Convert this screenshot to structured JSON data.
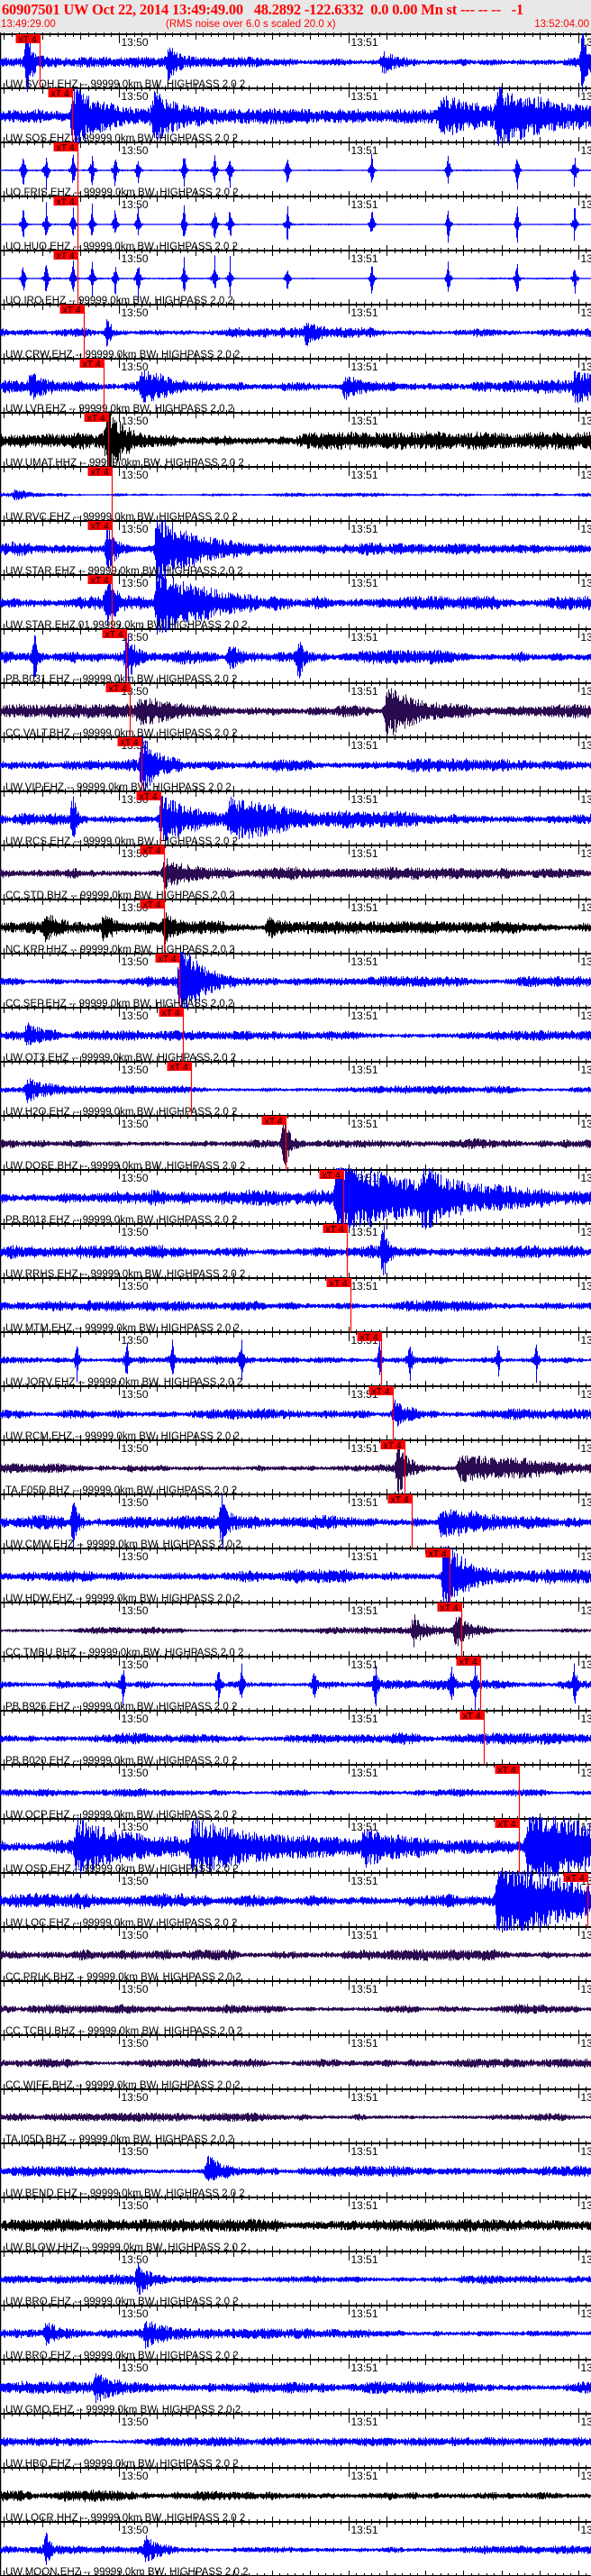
{
  "header": {
    "title": "60907501 UW Oct 22, 2014 13:49:49.00   48.2892 -122.6332  0.0 0.00 Mn st --- -- --   -1",
    "start_time": "13:49:29.00",
    "note": "(RMS noise over 6.0 s scaled 20.0 x)",
    "end_time": "13:52:04.00"
  },
  "chart_data": {
    "type": "line",
    "title": "60907501 UW Oct 22, 2014 13:49:49.00",
    "x_unit": "seconds after 13:49:29.00",
    "xlim": [
      0,
      154.4
    ],
    "tick_labels": [
      {
        "t": 31,
        "text": "13:50"
      },
      {
        "t": 91,
        "text": "13:51"
      },
      {
        "t": 151,
        "text": "13"
      }
    ],
    "pick_label": "xT 4",
    "colors": {
      "blue": "#0000ff",
      "black": "#000000",
      "purple": "#2a0a50",
      "pick": "#ff0000"
    },
    "traces": [
      {
        "label": "UW.SVOH.EHZ -- 99999.0km BW. HIGHPASS  2.0  2",
        "color": "blue",
        "noise": 0.15,
        "pick": 10.4,
        "events": [
          [
            7,
            1.1,
            1.5
          ],
          [
            44,
            0.6,
            2
          ],
          [
            100,
            0.4,
            3
          ],
          [
            152,
            1.1,
            1.5
          ]
        ]
      },
      {
        "label": "UW.SOS.EHZ -- 99999.0km BW. HIGHPASS  2.0  2",
        "color": "blue",
        "noise": 0.2,
        "pick": 18.8,
        "events": [
          [
            19,
            1.1,
            10
          ],
          [
            40,
            0.7,
            10
          ],
          [
            115,
            0.6,
            15
          ],
          [
            130,
            0.9,
            15
          ]
        ]
      },
      {
        "label": "UO.FRIS.EHZ -- 99999.0km BW. HIGHPASS  2.0  2",
        "color": "blue",
        "noise": 0.03,
        "pick": 20.2,
        "spikes": [
          6,
          12,
          19,
          24,
          30,
          36,
          48,
          56,
          60,
          75,
          97,
          117,
          135,
          150
        ]
      },
      {
        "label": "UO.HUO.EHZ -- 99999.0km BW. HIGHPASS  2.0  2",
        "color": "blue",
        "noise": 0.03,
        "pick": 20.2,
        "spikes": [
          6,
          12,
          19,
          24,
          30,
          36,
          48,
          56,
          60,
          75,
          97,
          117,
          135,
          150
        ]
      },
      {
        "label": "UO.IRO.EHZ -- 99999.0km BW. HIGHPASS  2.0  2",
        "color": "blue",
        "noise": 0.03,
        "pick": 20.2,
        "spikes": [
          6,
          12,
          19,
          24,
          30,
          36,
          48,
          56,
          60,
          75,
          97,
          117,
          135,
          150
        ]
      },
      {
        "label": "UW.CRW.EHZ -- 99999.0km BW. HIGHPASS  2.0  2",
        "color": "blue",
        "noise": 0.15,
        "pick": 21.9,
        "events": [
          [
            28,
            0.6,
            1
          ],
          [
            80,
            0.4,
            2
          ]
        ]
      },
      {
        "label": "UW.LVP.EHZ -- 99999.0km BW. HIGHPASS  2.0  2",
        "color": "blue",
        "noise": 0.2,
        "pick": 27.1,
        "events": [
          [
            8,
            0.4,
            4
          ],
          [
            37,
            0.6,
            5
          ],
          [
            90,
            0.4,
            6
          ],
          [
            150,
            0.4,
            8
          ]
        ]
      },
      {
        "label": "UW.UMAT.HHZ -- 99999.0km BW. HIGHPASS  2.0  2",
        "color": "black",
        "noise": 0.25,
        "pick": 28.2,
        "events": [
          [
            28,
            1.1,
            4
          ]
        ]
      },
      {
        "label": "UW.RVC.EHZ -- 99999.0km BW. HIGHPASS  2.0  2",
        "color": "blue",
        "noise": 0.06,
        "pick": 29.2,
        "events": [
          [
            4,
            0.2,
            3
          ]
        ]
      },
      {
        "label": "UW.STAR.EHZ -- 99999.0km BW. HIGHPASS  2.0  2",
        "color": "blue",
        "noise": 0.2,
        "pick": 29.2,
        "events": [
          [
            28,
            0.9,
            2
          ],
          [
            41,
            1.4,
            10
          ]
        ]
      },
      {
        "label": "UW.STAR.EHZ.01.99999.0km BW. HIGHPASS  2.0  2",
        "color": "blue",
        "noise": 0.2,
        "pick": 29.2,
        "events": [
          [
            28,
            0.9,
            2
          ],
          [
            41,
            1.4,
            10
          ]
        ]
      },
      {
        "label": "PB.B031.EHZ -- 99999.0km BW. HIGHPASS  2.0  2",
        "color": "blue",
        "noise": 0.2,
        "pick": 32.9,
        "events": [
          [
            9,
            1.0,
            0.8
          ],
          [
            33,
            1.0,
            2
          ],
          [
            60,
            0.5,
            3
          ],
          [
            78,
            0.9,
            1
          ]
        ]
      },
      {
        "label": "CC.VALT.BHZ -- 99999.0km BW. HIGHPASS  2.0  2",
        "color": "purple",
        "noise": 0.2,
        "pick": 33.9,
        "events": [
          [
            36,
            0.4,
            8
          ],
          [
            101,
            1.0,
            8
          ]
        ]
      },
      {
        "label": "UW.VIP.EHZ -- 99999.0km BW. HIGHPASS  2.0  2",
        "color": "blue",
        "noise": 0.2,
        "pick": 36.9,
        "events": [
          [
            37,
            1.1,
            3
          ]
        ]
      },
      {
        "label": "UW.RCS.EHZ -- 99999.0km BW. HIGHPASS  2.0  2",
        "color": "blue",
        "noise": 0.2,
        "pick": 41.9,
        "events": [
          [
            19,
            0.9,
            1
          ],
          [
            42,
            0.8,
            10
          ],
          [
            60,
            0.6,
            15
          ]
        ]
      },
      {
        "label": "CC.STD.BHZ -- 99999.0km BW. HIGHPASS  2.0  2",
        "color": "purple",
        "noise": 0.18,
        "pick": 42.8,
        "events": [
          [
            43,
            0.5,
            8
          ]
        ]
      },
      {
        "label": "NC.KRP.HHZ -- 99999.0km BW. HIGHPASS  2.0  2",
        "color": "black",
        "noise": 0.18,
        "pick": 42.8,
        "events": [
          [
            12,
            0.4,
            3
          ],
          [
            27,
            0.4,
            3
          ],
          [
            43,
            0.5,
            3
          ],
          [
            70,
            0.4,
            3
          ]
        ]
      },
      {
        "label": "CC.SEP.EHZ -- 99999.0km BW. HIGHPASS  2.0  2",
        "color": "blue",
        "noise": 0.15,
        "pick": 46.8,
        "events": [
          [
            47,
            1.4,
            6
          ]
        ]
      },
      {
        "label": "UW.OT3.EHZ -- 99999.0km BW. HIGHPASS  2.0  2",
        "color": "blue",
        "noise": 0.15,
        "pick": 47.8,
        "events": [
          [
            7,
            0.4,
            4
          ]
        ]
      },
      {
        "label": "UW.H2O.EHZ -- 99999.0km BW. HIGHPASS  2.0  2",
        "color": "blue",
        "noise": 0.12,
        "pick": 49.9,
        "events": [
          [
            7,
            0.4,
            4
          ]
        ]
      },
      {
        "label": "UW.DOSE.BHZ -- 99999.0km BW. HIGHPASS  2.0  2",
        "color": "purple",
        "noise": 0.15,
        "pick": 74.6,
        "events": [
          [
            74,
            1.1,
            1.5
          ]
        ]
      },
      {
        "label": "PB.B013.EHZ -- 99999.0km BW. HIGHPASS  2.0  2",
        "color": "blue",
        "noise": 0.22,
        "pick": 89.6,
        "events": [
          [
            88,
            1.4,
            20
          ],
          [
            110,
            0.7,
            8
          ]
        ]
      },
      {
        "label": "UW.RRHS.EHZ -- 99999.0km BW. HIGHPASS  2.0  2",
        "color": "blue",
        "noise": 0.2,
        "pick": 90.6,
        "events": [
          [
            100,
            1.0,
            1
          ]
        ]
      },
      {
        "label": "UW.MTM.EHZ -- 99999.0km BW. HIGHPASS  2.0  2",
        "color": "blue",
        "noise": 0.16,
        "pick": 91.5,
        "events": []
      },
      {
        "label": "UW.JORV.EHZ -- 99999.0km BW. HIGHPASS  2.0  2",
        "color": "blue",
        "noise": 0.12,
        "pick": 99.5,
        "spikes": [
          20,
          33,
          45,
          63,
          99,
          107,
          130,
          140
        ]
      },
      {
        "label": "UW.RCM.EHZ -- 99999.0km BW. HIGHPASS  2.0  2",
        "color": "blue",
        "noise": 0.16,
        "pick": 102.6,
        "events": [
          [
            103,
            0.5,
            3
          ]
        ]
      },
      {
        "label": "TA.F05D.BHZ -- 99999.0km BW. HIGHPASS  2.0  2",
        "color": "purple",
        "noise": 0.14,
        "pick": 105.6,
        "events": [
          [
            104,
            1.1,
            2
          ],
          [
            120,
            0.5,
            20
          ]
        ]
      },
      {
        "label": "UW.CMW.EHZ -- 99999.0km BW. HIGHPASS  2.0  2",
        "color": "blue",
        "noise": 0.2,
        "pick": 107.5,
        "events": [
          [
            19,
            1.0,
            1
          ],
          [
            58,
            1.0,
            1
          ],
          [
            115,
            0.5,
            15
          ]
        ]
      },
      {
        "label": "UW.HDW.EHZ -- 99999.0km BW. HIGHPASS  2.0  2",
        "color": "blue",
        "noise": 0.2,
        "pick": 117.4,
        "events": [
          [
            116,
            1.5,
            6
          ]
        ]
      },
      {
        "label": "CC.TMBU.BHZ -- 99999.0km BW. HIGHPASS  2.0  2",
        "color": "purple",
        "noise": 0.1,
        "pick": 120.5,
        "events": [
          [
            108,
            0.6,
            3
          ],
          [
            119,
            0.6,
            4
          ]
        ]
      },
      {
        "label": "PB.B926.EHZ -- 99999.0km BW. HIGHPASS  2.0  2",
        "color": "blue",
        "noise": 0.15,
        "pick": 125.4,
        "spikes": [
          32,
          57,
          63,
          82,
          98,
          118,
          124,
          150
        ]
      },
      {
        "label": "PB.B020.EHZ -- 99999.0km BW. HIGHPASS  2.0  2",
        "color": "blue",
        "noise": 0.17,
        "pick": 126.4,
        "events": []
      },
      {
        "label": "UW.OCP.EHZ -- 99999.0km BW. HIGHPASS  2.0  2",
        "color": "blue",
        "noise": 0.12,
        "pick": 135.5,
        "events": []
      },
      {
        "label": "UW.OSD.EHZ -- 99999.0km BW. HIGHPASS  2.0  2",
        "color": "blue",
        "noise": 0.25,
        "pick": 135.5,
        "events": [
          [
            20,
            0.9,
            10
          ],
          [
            50,
            0.8,
            15
          ],
          [
            95,
            0.6,
            10
          ],
          [
            138,
            1.5,
            25
          ]
        ]
      },
      {
        "label": "UW.LOC.EHZ -- 99999.0km BW. HIGHPASS  2.0  2",
        "color": "blue",
        "noise": 0.22,
        "pick": 153.4,
        "events": [
          [
            130,
            1.5,
            25
          ]
        ]
      },
      {
        "label": "CC.PRLK.BHZ -- 99999.0km BW. HIGHPASS  2.0  2",
        "color": "purple",
        "noise": 0.16,
        "events": []
      },
      {
        "label": "CC.TCBU.BHZ -- 99999.0km BW. HIGHPASS  2.0  2",
        "color": "purple",
        "noise": 0.14,
        "events": []
      },
      {
        "label": "CC.WIFE.BHZ -- 99999.0km BW. HIGHPASS  2.0  2",
        "color": "purple",
        "noise": 0.13,
        "events": []
      },
      {
        "label": "TA.I05D.BHZ -- 99999.0km BW. HIGHPASS  2.0  2",
        "color": "purple",
        "noise": 0.13,
        "events": []
      },
      {
        "label": "UW.BEND.EHZ -- 99999.0km BW. HIGHPASS  2.0  2",
        "color": "blue",
        "noise": 0.15,
        "events": [
          [
            54,
            0.6,
            4
          ]
        ]
      },
      {
        "label": "UW.BLOW.HHZ -- 99999.0km BW. HIGHPASS  2.0  2",
        "color": "black",
        "noise": 0.18,
        "events": []
      },
      {
        "label": "UW.BRO.EHZ -- 99999.0km BW. HIGHPASS  2.0  2",
        "color": "blue",
        "noise": 0.15,
        "events": [
          [
            36,
            0.5,
            4
          ]
        ]
      },
      {
        "label": "UW.BRO.EHZ -- 99999.0km BW. HIGHPASS  2.0  2",
        "color": "blue",
        "noise": 0.15,
        "events": [
          [
            12,
            0.4,
            5
          ],
          [
            38,
            0.4,
            4
          ]
        ]
      },
      {
        "label": "UW.GMO.EHZ -- 99999.0km BW. HIGHPASS  2.0  2",
        "color": "blue",
        "noise": 0.18,
        "events": [
          [
            25,
            0.4,
            6
          ]
        ]
      },
      {
        "label": "UW.HBO.EHZ -- 99999.0km BW. HIGHPASS  2.0  2",
        "color": "blue",
        "noise": 0.13,
        "events": []
      },
      {
        "label": "UW.LOCR.HHZ -- 99999.0km BW. HIGHPASS  2.0  2",
        "color": "black",
        "noise": 0.17,
        "events": []
      },
      {
        "label": "UW.MOON.EHZ -- 99999.0km BW. HIGHPASS  2.0  2",
        "color": "blue",
        "noise": 0.12,
        "events": [
          [
            12,
            0.7,
            1
          ],
          [
            38,
            0.5,
            3
          ]
        ]
      }
    ]
  }
}
